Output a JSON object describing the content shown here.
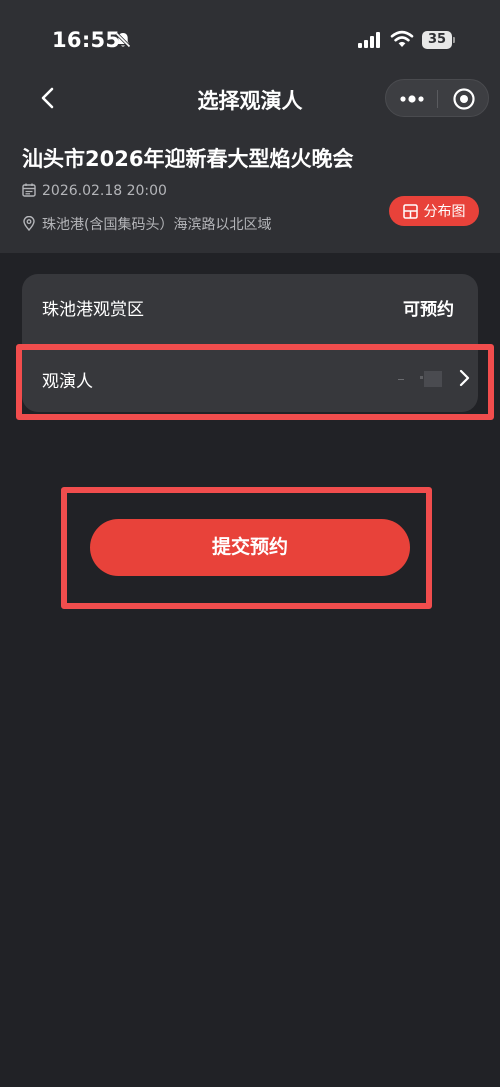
{
  "status_bar": {
    "time": "16:55",
    "battery": "35"
  },
  "nav": {
    "title": "选择观演人"
  },
  "event": {
    "title": "汕头市2026年迎新春大型焰火晚会",
    "datetime": "2026.02.18 20:00",
    "location": "珠池港(含国集码头）海滨路以北区域",
    "map_button": "分布图"
  },
  "form": {
    "area_label": "珠池港观赏区",
    "area_status": "可预约",
    "viewer_label": "观演人"
  },
  "actions": {
    "submit": "提交预约"
  },
  "colors": {
    "accent": "#e8423a",
    "highlight": "#f14d4d",
    "background": "#212226",
    "header": "#2f3034",
    "card": "#37383c"
  },
  "icons": [
    "bell-slash-icon",
    "signal-icon",
    "wifi-icon",
    "battery-icon",
    "back-icon",
    "more-icon",
    "target-icon",
    "calendar-icon",
    "location-icon",
    "map-icon",
    "chevron-right-icon"
  ]
}
